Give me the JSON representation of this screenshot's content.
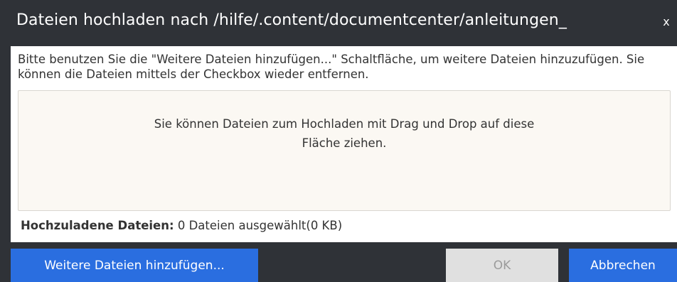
{
  "dialog": {
    "title": "Dateien hochladen nach /hilfe/.content/documentcenter/anleitungen_",
    "close_symbol": "x",
    "intro_text": "Bitte benutzen Sie die \"Weitere Dateien hinzufügen...\" Schaltfläche, um weitere Dateien hinzuzufügen. Sie können die Dateien mittels der Checkbox wieder entfernen.",
    "dropzone_line1": "Sie können Dateien zum Hochladen mit Drag und Drop auf diese",
    "dropzone_line2": "Fläche ziehen.",
    "files_label": "Hochzuladene Dateien:",
    "files_value": " 0 Dateien ausgewählt(0 KB)",
    "buttons": {
      "add_label": "Weitere Dateien hinzufügen...",
      "ok_label": "OK",
      "cancel_label": "Abbrechen"
    }
  },
  "colors": {
    "titlebar": "#2f3237",
    "primary_button": "#2a6ee0",
    "disabled_button": "#e0e0e0",
    "dropzone_bg": "#fbf8f3"
  }
}
